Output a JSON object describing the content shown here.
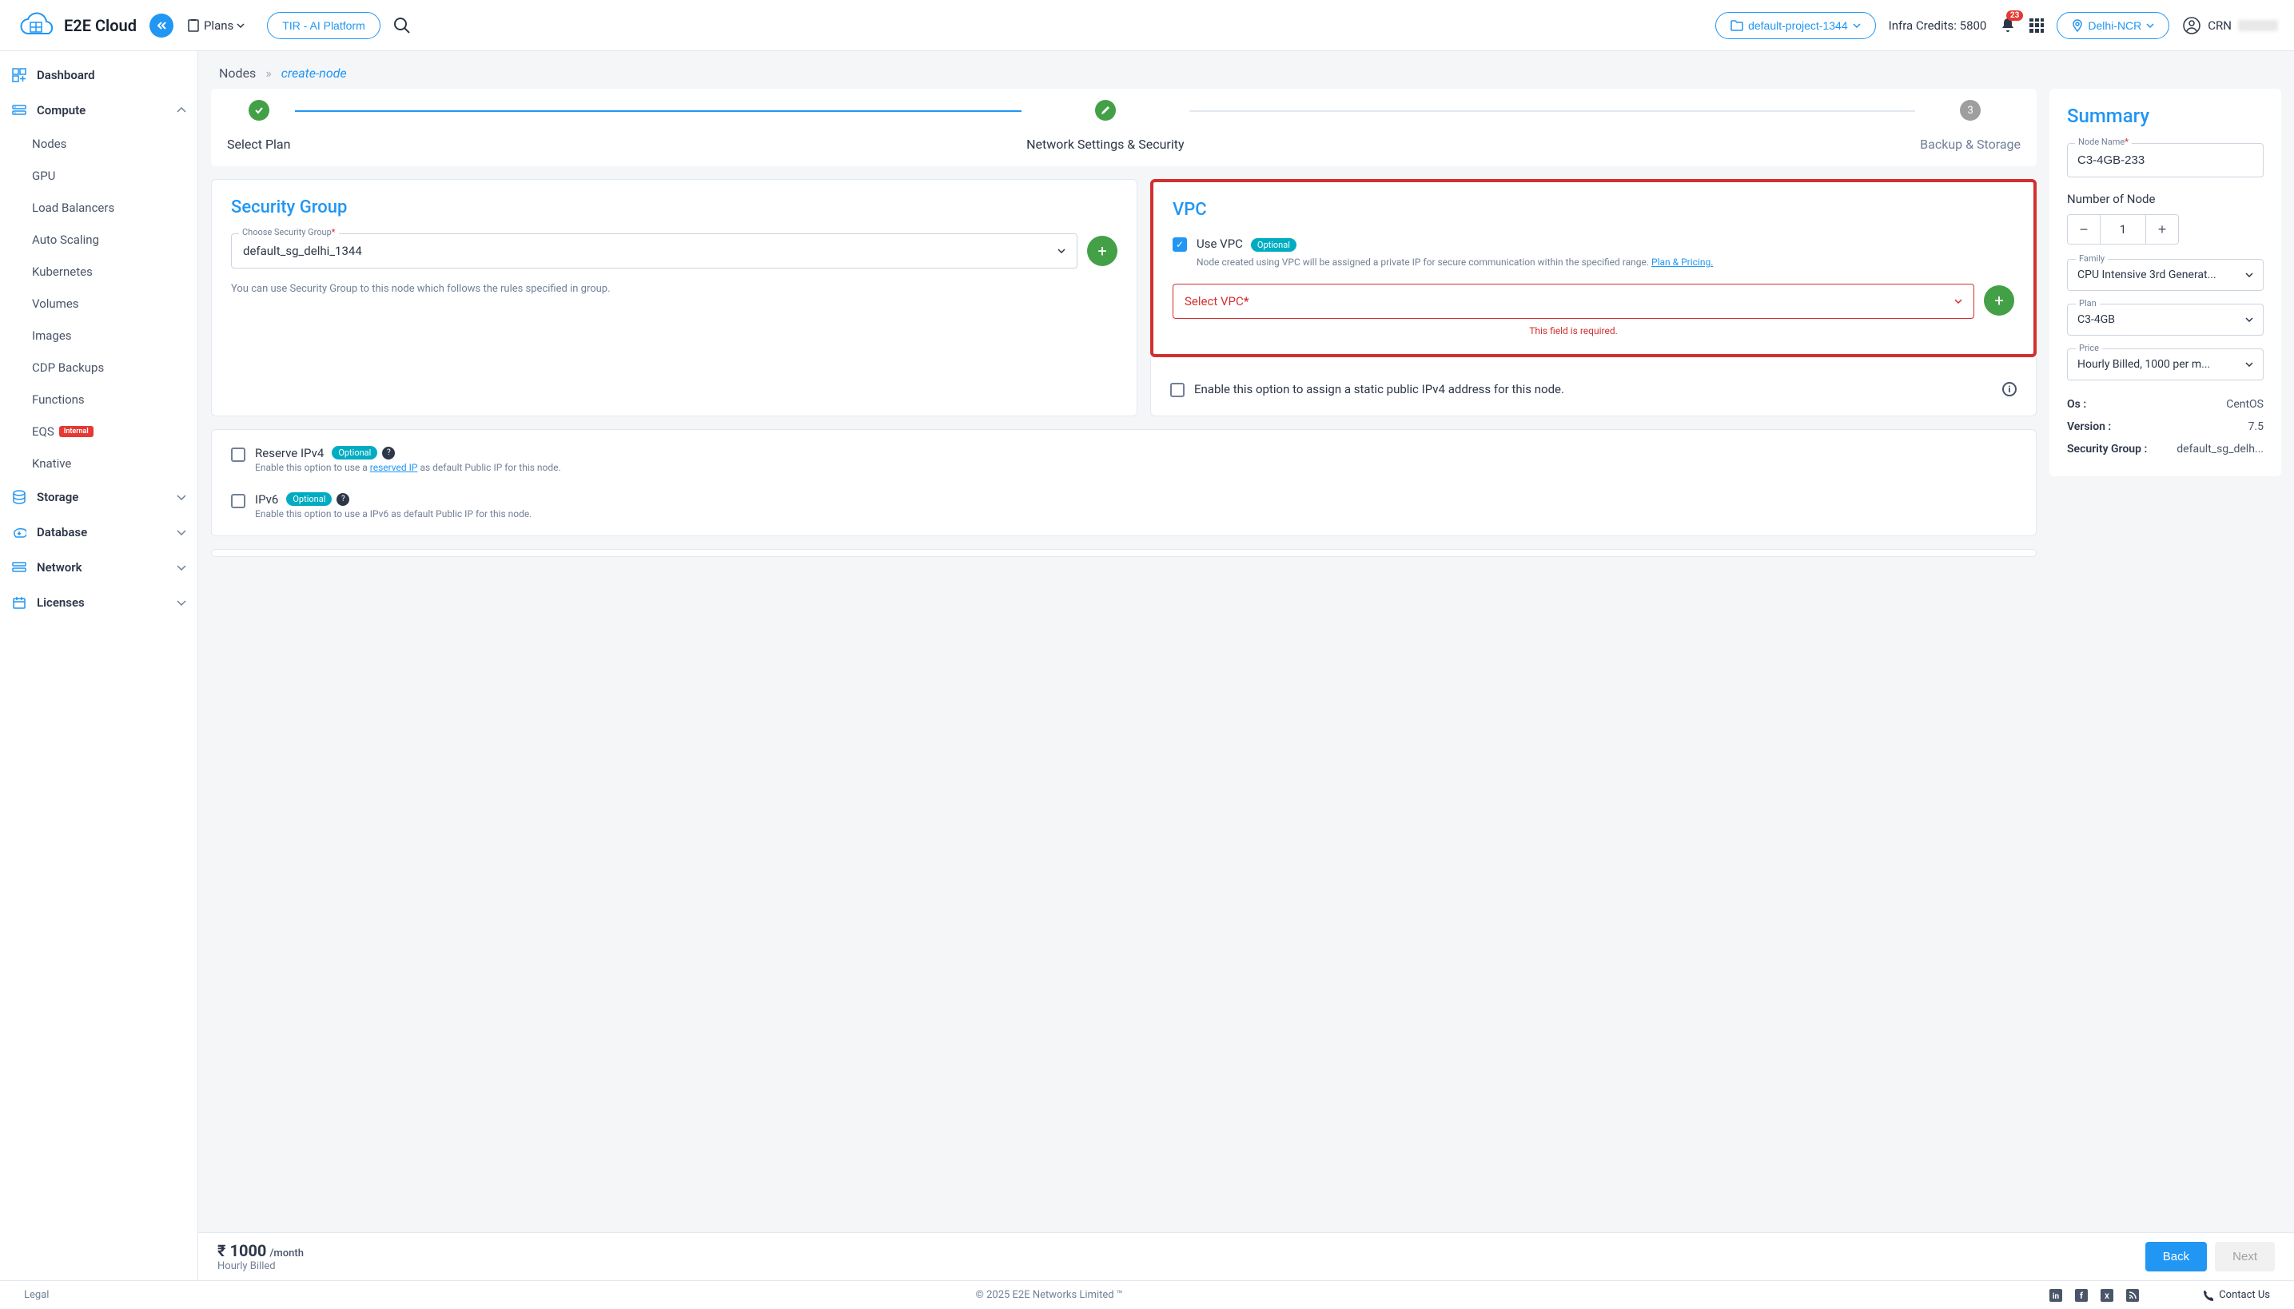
{
  "header": {
    "logo_text": "E2E Cloud",
    "plans_label": "Plans",
    "tir_label": "TIR - AI Platform",
    "project_label": "default-project-1344",
    "infra_credits": "Infra Credits: 5800",
    "notification_count": "23",
    "region_label": "Delhi-NCR",
    "crn_label": "CRN"
  },
  "sidebar": {
    "dashboard": "Dashboard",
    "compute": "Compute",
    "compute_items": {
      "nodes": "Nodes",
      "gpu": "GPU",
      "load_balancers": "Load Balancers",
      "auto_scaling": "Auto Scaling",
      "kubernetes": "Kubernetes",
      "volumes": "Volumes",
      "images": "Images",
      "cdp_backups": "CDP Backups",
      "functions": "Functions",
      "eqs": "EQS",
      "eqs_badge": "Internal",
      "knative": "Knative"
    },
    "storage": "Storage",
    "database": "Database",
    "network": "Network",
    "licenses": "Licenses"
  },
  "breadcrumb": {
    "root": "Nodes",
    "current": "create-node"
  },
  "wizard": {
    "step1": "Select Plan",
    "step2": "Network Settings & Security",
    "step3": "Backup & Storage",
    "step3_num": "3"
  },
  "security_group": {
    "title": "Security Group",
    "select_label": "Choose Security Group",
    "select_value": "default_sg_delhi_1344",
    "help": "You can use Security Group to this node which follows the rules specified in group."
  },
  "vpc": {
    "title": "VPC",
    "use_vpc_label": "Use VPC",
    "optional": "Optional",
    "desc": "Node created using VPC will be assigned a private IP for secure communication within the specified range. ",
    "plan_link": "Plan & Pricing.",
    "select_placeholder": "Select VPC",
    "error": "This field is required.",
    "static_ip_label": "Enable this option to assign a static public IPv4 address for this node."
  },
  "reserve_ipv4": {
    "title": "Reserve IPv4",
    "optional": "Optional",
    "desc_pre": "Enable this option to use a ",
    "desc_link": "reserved IP",
    "desc_post": " as default Public IP for this node."
  },
  "ipv6": {
    "title": "IPv6",
    "optional": "Optional",
    "desc": "Enable this option to use a IPv6 as default Public IP for this node."
  },
  "summary": {
    "title": "Summary",
    "node_name_label": "Node Name",
    "node_name_value": "C3-4GB-233",
    "number_label": "Number of Node",
    "number_value": "1",
    "family_label": "Family",
    "family_value": "CPU Intensive 3rd Generat...",
    "plan_label": "Plan",
    "plan_value": "C3-4GB",
    "price_label": "Price",
    "price_value": "Hourly Billed, 1000 per m...",
    "os_key": "Os :",
    "os_val": "CentOS",
    "version_key": "Version :",
    "version_val": "7.5",
    "sg_key": "Security Group :",
    "sg_val": "default_sg_delh..."
  },
  "bottom": {
    "price": "₹ 1000",
    "unit": "/month",
    "billing": "Hourly Billed",
    "back": "Back",
    "next": "Next"
  },
  "footer": {
    "legal": "Legal",
    "copyright": "© 2025 E2E Networks Limited ™",
    "contact": "Contact Us"
  }
}
